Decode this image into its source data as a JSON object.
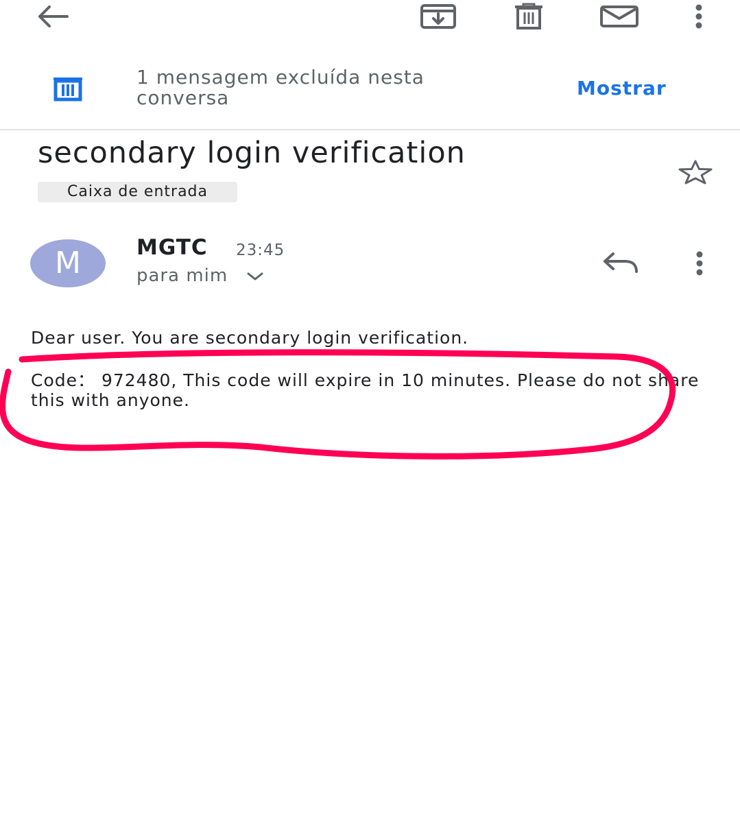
{
  "toolbar": {
    "back_icon": "arrow-left-icon",
    "archive_icon": "archive-icon",
    "delete_icon": "trash-icon",
    "mark_unread_icon": "envelope-icon",
    "more_icon": "more-vert-icon"
  },
  "banner": {
    "icon": "trash-icon",
    "text": "1 mensagem excluída nesta conversa",
    "action_label": "Mostrar"
  },
  "email": {
    "subject": "secondary login verification",
    "label": "Caixa de entrada",
    "star_icon": "star-outline-icon",
    "sender_initial": "M",
    "sender": "MGTC",
    "time": "23:45",
    "recipient": "para mim",
    "body": [
      "Dear user. You are secondary login verification.",
      "Code： 972480, This code will expire in 10 minutes. Please do not share this with anyone."
    ]
  },
  "colors": {
    "accent_blue": "#1a73e8",
    "avatar": "#9fa8da",
    "annotation_stroke": "#ff0055"
  }
}
